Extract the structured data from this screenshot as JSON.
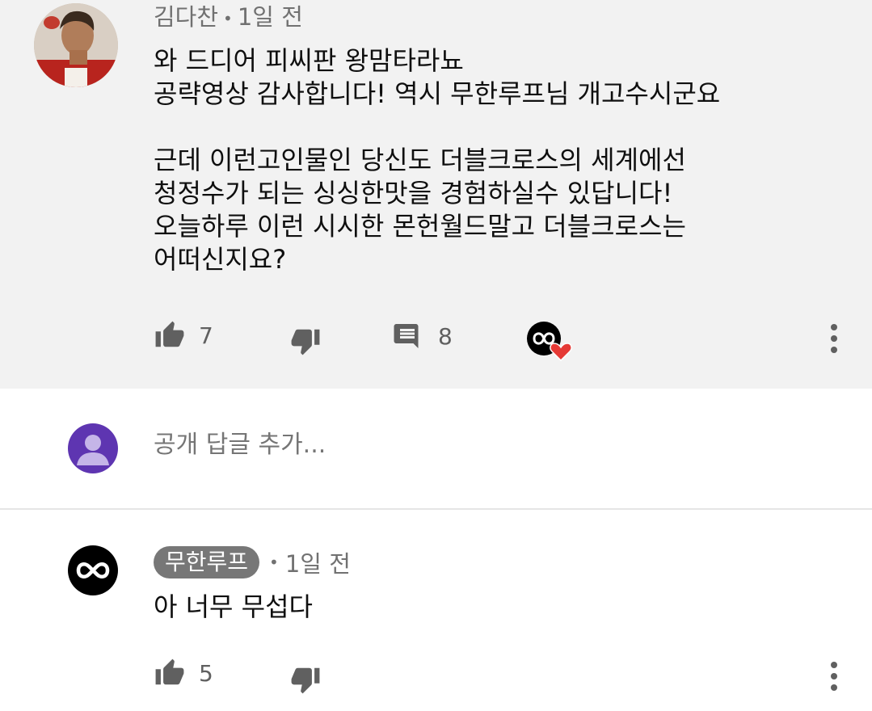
{
  "comment": {
    "author": "김다찬",
    "time": "1일 전",
    "lines": [
      "와 드디어 피씨판 왕맘타라뇨",
      "공략영상 감사합니다! 역시 무한루프님 개고수시군요",
      "",
      "근데 이런고인물인 당신도 더블크로스의 세계에선",
      "청정수가 되는 싱싱한맛을 경험하실수 있답니다!",
      "오늘하루 이런 시시한 몬헌월드말고 더블크로스는",
      "어떠신지요?"
    ],
    "like_count": "7",
    "reply_count": "8"
  },
  "reply_box": {
    "placeholder": "공개 답글 추가..."
  },
  "reply": {
    "author": "무한루프",
    "time": "1일 전",
    "text": "아 너무 무섭다",
    "like_count": "5"
  },
  "icons": {
    "like": "thumb-up-icon",
    "dislike": "thumb-down-icon",
    "replies": "comment-icon",
    "creator_heart": "creator-heart-icon",
    "more": "more-vert-icon"
  },
  "colors": {
    "heart": "#e53935",
    "badge": "#777777",
    "user_avatar": "#5e35b1"
  }
}
